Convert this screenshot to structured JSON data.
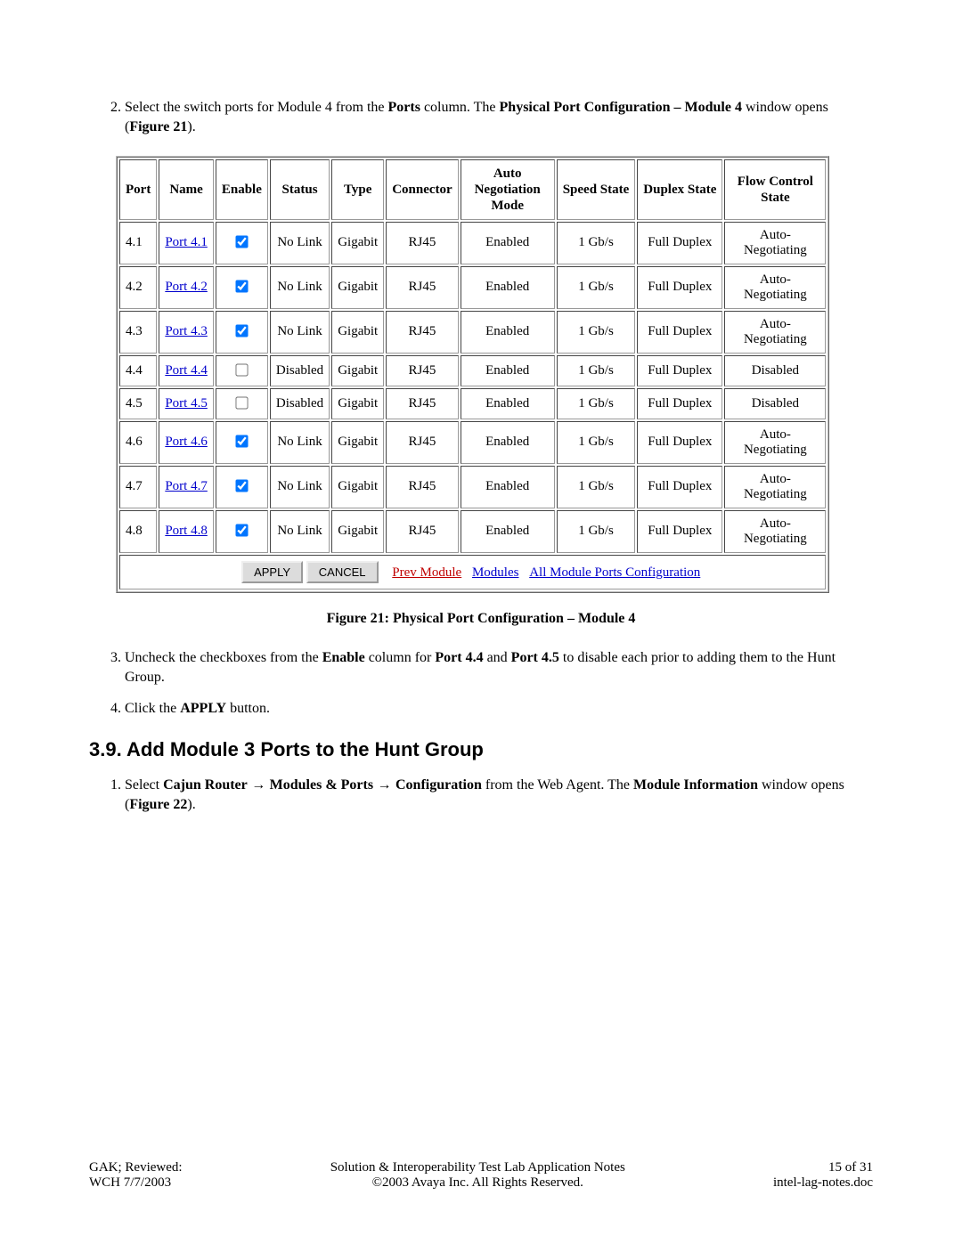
{
  "step2": {
    "num": "2.",
    "prefix": "Select the switch ports for Module 4 from the ",
    "b1": "Ports",
    "mid1": " column.  The ",
    "b2": "Physical Port Configuration – Module 4",
    "mid2": " window opens (",
    "b3": "Figure 21",
    "suffix": ")."
  },
  "table": {
    "headers": [
      "Port",
      "Name",
      "Enable",
      "Status",
      "Type",
      "Connector",
      "Auto Negotiation Mode",
      "Speed State",
      "Duplex State",
      "Flow Control State"
    ],
    "rows": [
      {
        "port": "4.1",
        "name": "Port 4.1",
        "enable": true,
        "status": "No Link",
        "type": "Gigabit",
        "connector": "RJ45",
        "auto": "Enabled",
        "speed": "1 Gb/s",
        "duplex": "Full Duplex",
        "flow": "Auto-Negotiating"
      },
      {
        "port": "4.2",
        "name": "Port 4.2",
        "enable": true,
        "status": "No Link",
        "type": "Gigabit",
        "connector": "RJ45",
        "auto": "Enabled",
        "speed": "1 Gb/s",
        "duplex": "Full Duplex",
        "flow": "Auto-Negotiating"
      },
      {
        "port": "4.3",
        "name": "Port 4.3",
        "enable": true,
        "status": "No Link",
        "type": "Gigabit",
        "connector": "RJ45",
        "auto": "Enabled",
        "speed": "1 Gb/s",
        "duplex": "Full Duplex",
        "flow": "Auto-Negotiating"
      },
      {
        "port": "4.4",
        "name": "Port 4.4",
        "enable": false,
        "status": "Disabled",
        "type": "Gigabit",
        "connector": "RJ45",
        "auto": "Enabled",
        "speed": "1 Gb/s",
        "duplex": "Full Duplex",
        "flow": "Disabled"
      },
      {
        "port": "4.5",
        "name": "Port 4.5",
        "enable": false,
        "status": "Disabled",
        "type": "Gigabit",
        "connector": "RJ45",
        "auto": "Enabled",
        "speed": "1 Gb/s",
        "duplex": "Full Duplex",
        "flow": "Disabled"
      },
      {
        "port": "4.6",
        "name": "Port 4.6",
        "enable": true,
        "status": "No Link",
        "type": "Gigabit",
        "connector": "RJ45",
        "auto": "Enabled",
        "speed": "1 Gb/s",
        "duplex": "Full Duplex",
        "flow": "Auto-Negotiating"
      },
      {
        "port": "4.7",
        "name": "Port 4.7",
        "enable": true,
        "status": "No Link",
        "type": "Gigabit",
        "connector": "RJ45",
        "auto": "Enabled",
        "speed": "1 Gb/s",
        "duplex": "Full Duplex",
        "flow": "Auto-Negotiating"
      },
      {
        "port": "4.8",
        "name": "Port 4.8",
        "enable": true,
        "status": "No Link",
        "type": "Gigabit",
        "connector": "RJ45",
        "auto": "Enabled",
        "speed": "1 Gb/s",
        "duplex": "Full Duplex",
        "flow": "Auto-Negotiating"
      }
    ],
    "buttons": {
      "apply": "APPLY",
      "cancel": "CANCEL",
      "prev": "Prev Module",
      "modules": "Modules",
      "allports": "All Module Ports Configuration"
    }
  },
  "caption": "Figure 21: Physical Port Configuration – Module 4",
  "step3": {
    "num": "3.",
    "prefix": "Uncheck the checkboxes from the ",
    "b1": "Enable",
    "mid1": " column for ",
    "b2": "Port 4.4",
    "mid2": " and ",
    "b3": "Port 4.5",
    "suffix": " to disable each prior to adding them to the Hunt Group."
  },
  "step4": {
    "num": "4.",
    "prefix": "Click the ",
    "b1": "APPLY",
    "suffix": " button."
  },
  "section": "3.9.  Add Module 3 Ports to the Hunt Group",
  "step39_1": {
    "num": "1.",
    "prefix": "Select ",
    "b1": "Cajun Router",
    "arrow": " → ",
    "b2": "Modules & Ports",
    "b3": "Configuration",
    "mid": " from the Web Agent.  The ",
    "b4": "Module Information",
    "mid2": " window opens (",
    "b5": "Figure 22",
    "suffix": ")."
  },
  "footer": {
    "left1": "GAK; Reviewed:",
    "left2": "WCH 7/7/2003",
    "center1": "Solution & Interoperability Test Lab Application Notes",
    "center2": "©2003 Avaya Inc. All Rights Reserved.",
    "right1": "15 of 31",
    "right2": "intel-lag-notes.doc"
  }
}
